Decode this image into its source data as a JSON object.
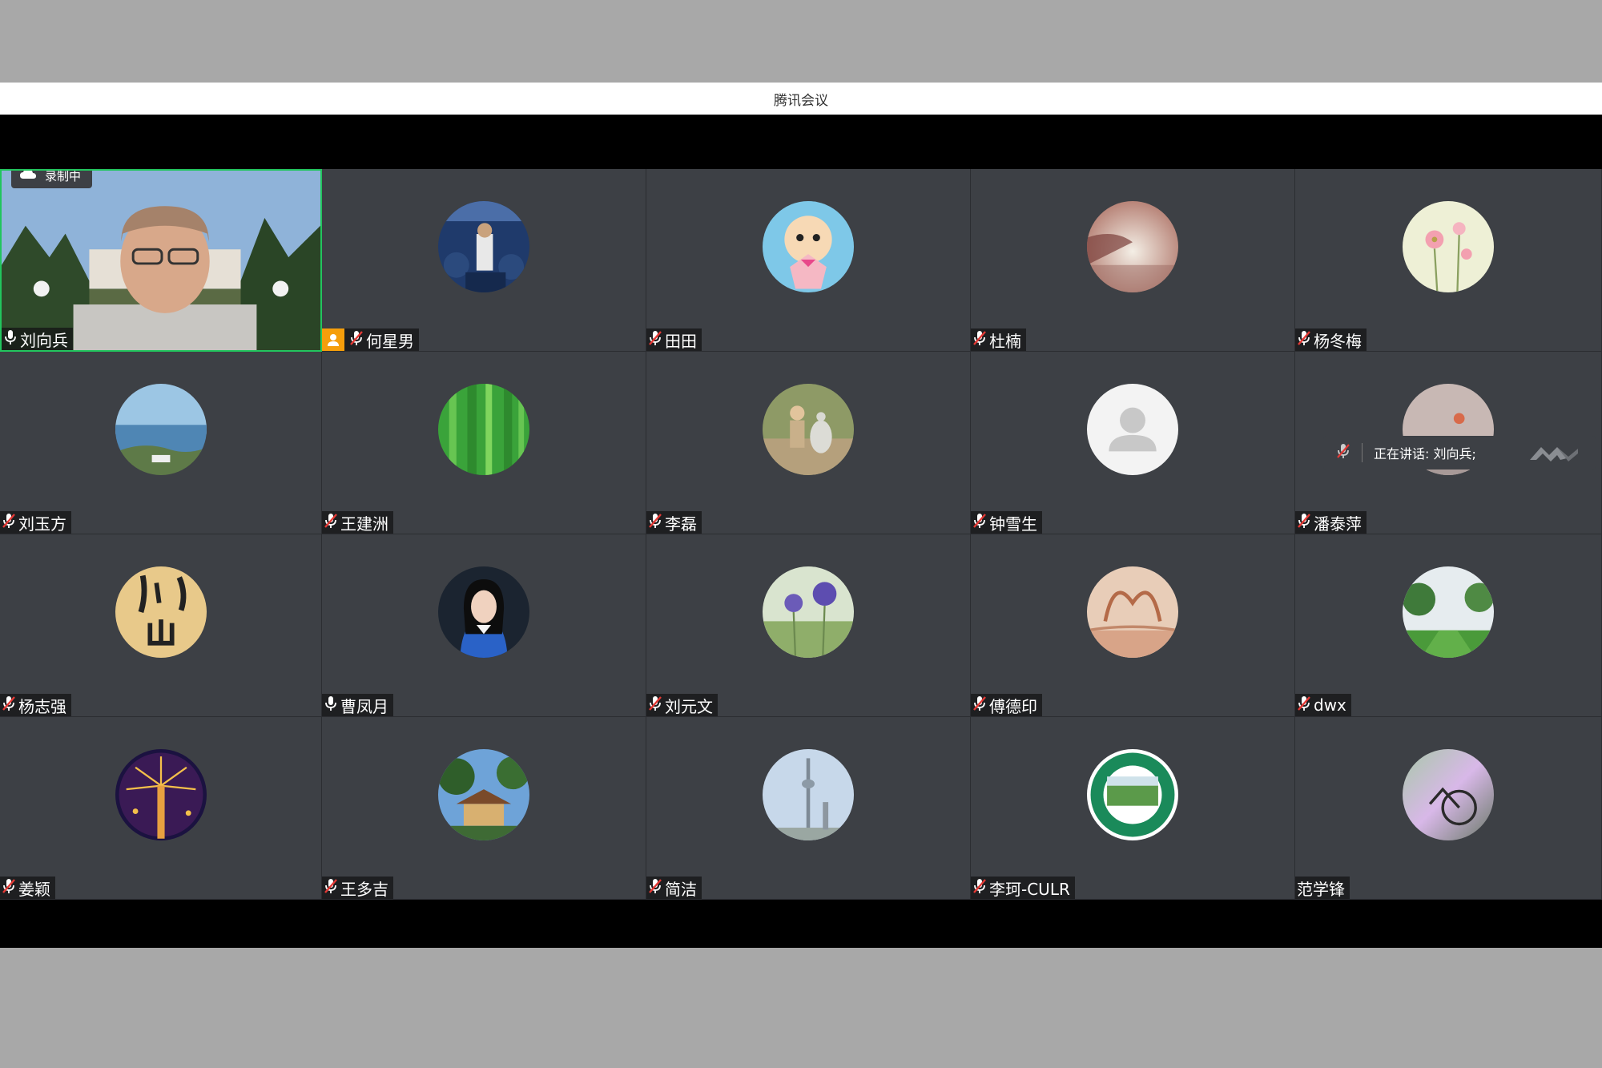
{
  "window": {
    "title": "腾讯会议"
  },
  "recording": {
    "label": "录制中"
  },
  "speaking": {
    "label": "正在讲话: 刘向兵;"
  },
  "participants": [
    {
      "name": "刘向兵",
      "mic": "on",
      "video": true,
      "active": true,
      "avatar": "video-feed"
    },
    {
      "name": "何星男",
      "mic": "muted",
      "host": true,
      "avatar": "concert"
    },
    {
      "name": "田田",
      "mic": "muted",
      "avatar": "doll"
    },
    {
      "name": "杜楠",
      "mic": "muted",
      "avatar": "sunset-lake"
    },
    {
      "name": "杨冬梅",
      "mic": "muted",
      "avatar": "flowers"
    },
    {
      "name": "刘玉方",
      "mic": "muted",
      "avatar": "coast"
    },
    {
      "name": "王建洲",
      "mic": "muted",
      "avatar": "bamboo"
    },
    {
      "name": "李磊",
      "mic": "muted",
      "avatar": "child-goose"
    },
    {
      "name": "钟雪生",
      "mic": "muted",
      "avatar": "default-user"
    },
    {
      "name": "潘泰萍",
      "mic": "muted",
      "avatar": "dusk"
    },
    {
      "name": "杨志强",
      "mic": "muted",
      "avatar": "calligraphy"
    },
    {
      "name": "曹凤月",
      "mic": "on",
      "avatar": "portrait"
    },
    {
      "name": "刘元文",
      "mic": "muted",
      "avatar": "thistle"
    },
    {
      "name": "傅德印",
      "mic": "muted",
      "avatar": "autumn-trees"
    },
    {
      "name": "dwx",
      "mic": "muted",
      "avatar": "park"
    },
    {
      "name": "姜颖",
      "mic": "muted",
      "avatar": "fireworks"
    },
    {
      "name": "王多吉",
      "mic": "muted",
      "avatar": "pavilion"
    },
    {
      "name": "简洁",
      "mic": "muted",
      "avatar": "tv-tower"
    },
    {
      "name": "李珂-CULR",
      "mic": "muted",
      "avatar": "university-seal"
    },
    {
      "name": "范学锋",
      "mic": "none",
      "avatar": "bicycle"
    }
  ],
  "colors": {
    "tile": "#3d4045",
    "active_border": "#22c55e",
    "muted_red": "#e53935",
    "host": "#f59e0b"
  }
}
